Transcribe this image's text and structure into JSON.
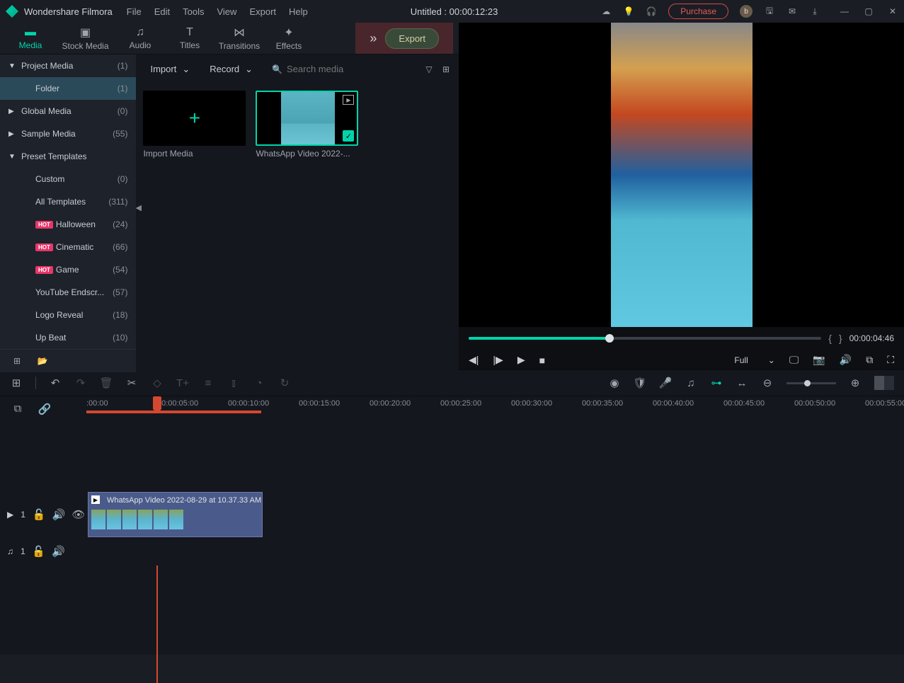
{
  "app": {
    "title": "Wondershare Filmora",
    "project_title": "Untitled : 00:00:12:23"
  },
  "menu": [
    "File",
    "Edit",
    "Tools",
    "View",
    "Export",
    "Help"
  ],
  "titlebar": {
    "purchase": "Purchase",
    "avatar": "b"
  },
  "main_tabs": [
    {
      "id": "media",
      "label": "Media",
      "icon": "📁"
    },
    {
      "id": "stock",
      "label": "Stock Media",
      "icon": "🖼"
    },
    {
      "id": "audio",
      "label": "Audio",
      "icon": "♫"
    },
    {
      "id": "titles",
      "label": "Titles",
      "icon": "T"
    },
    {
      "id": "transitions",
      "label": "Transitions",
      "icon": "✕"
    },
    {
      "id": "effects",
      "label": "Effects",
      "icon": "✦"
    }
  ],
  "export_btn": "Export",
  "sidebar": {
    "items": [
      {
        "label": "Project Media",
        "count": "(1)",
        "chev": "▼",
        "indent": 0
      },
      {
        "label": "Folder",
        "count": "(1)",
        "indent": 1,
        "selected": true
      },
      {
        "label": "Global Media",
        "count": "(0)",
        "chev": "▶",
        "indent": 0
      },
      {
        "label": "Sample Media",
        "count": "(55)",
        "chev": "▶",
        "indent": 0
      },
      {
        "label": "Preset Templates",
        "count": "",
        "chev": "▼",
        "indent": 0
      },
      {
        "label": "Custom",
        "count": "(0)",
        "indent": 1
      },
      {
        "label": "All Templates",
        "count": "(311)",
        "indent": 1
      },
      {
        "label": "Halloween",
        "count": "(24)",
        "indent": 1,
        "hot": true
      },
      {
        "label": "Cinematic",
        "count": "(66)",
        "indent": 1,
        "hot": true
      },
      {
        "label": "Game",
        "count": "(54)",
        "indent": 1,
        "hot": true
      },
      {
        "label": "YouTube Endscr...",
        "count": "(57)",
        "indent": 1
      },
      {
        "label": "Logo Reveal",
        "count": "(18)",
        "indent": 1
      },
      {
        "label": "Up Beat",
        "count": "(10)",
        "indent": 1
      }
    ],
    "hot_label": "HOT"
  },
  "media_toolbar": {
    "import": "Import",
    "record": "Record",
    "search_placeholder": "Search media"
  },
  "media_items": {
    "import_label": "Import Media",
    "clip1_label": "WhatsApp Video 2022-..."
  },
  "preview": {
    "time": "00:00:04:46",
    "quality": "Full"
  },
  "timeline": {
    "ruler": [
      ":00:00",
      "00:00:05:00",
      "00:00:10:00",
      "00:00:15:00",
      "00:00:20:00",
      "00:00:25:00",
      "00:00:30:00",
      "00:00:35:00",
      "00:00:40:00",
      "00:00:45:00",
      "00:00:50:00",
      "00:00:55:00"
    ],
    "clip_label": "WhatsApp Video 2022-08-29 at 10.37.33 AM",
    "video_track": "1",
    "audio_track": "1"
  }
}
